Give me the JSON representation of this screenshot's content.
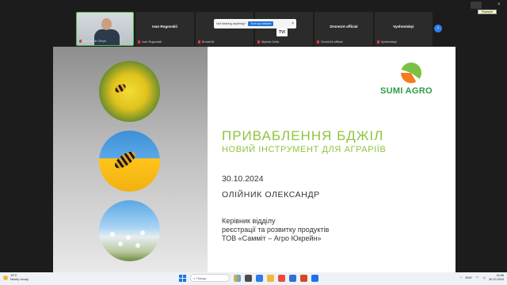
{
  "meeting": {
    "participants": [
      {
        "name": "",
        "label": "Oleksandr Olinyk",
        "kind": "video"
      },
      {
        "name": "Ivan Rogovskii",
        "label": "Ivan Rogovskii",
        "kind": "name"
      },
      {
        "name": "",
        "label": "DroneUA",
        "kind": "name"
      },
      {
        "name": "",
        "label": "Mykola Golia",
        "kind": "name"
      },
      {
        "name": "DroneUA official",
        "label": "DroneUA official",
        "kind": "name"
      },
      {
        "name": "Vyshnotskyi",
        "label": "Vyshnotskyi",
        "kind": "name"
      }
    ],
    "popup": {
      "text": "Not hearing anything?",
      "button": "Turn up volume",
      "close": "×"
    },
    "tv_label": "TVI",
    "next_icon": "chevron-right-icon",
    "tooltip": "Згорнути"
  },
  "slide": {
    "logo": "SUMI AGRO",
    "title": "ПРИВАБЛЕННЯ БДЖІЛ",
    "subtitle": "НОВИЙ ІНСТРУМЕНТ ДЛЯ АГРАРІЇВ",
    "date": "30.10.2024",
    "author": "ОЛІЙНИК ОЛЕКСАНДР",
    "role_line1": "Керівник відділу",
    "role_line2": "реєстрації та розвитку продуктів",
    "role_line3": "ТОВ «Саммiт – Агро Юкрейн»",
    "colors": {
      "accent": "#8dc53e",
      "logo_green": "#2e9b47",
      "logo_orange": "#f47b20"
    }
  },
  "taskbar": {
    "weather_temp": "13°C",
    "weather_desc": "Mostly cloudy",
    "search_placeholder": "Пошук",
    "lang": "ENG",
    "time": "15:36",
    "date": "30.10.2024"
  }
}
